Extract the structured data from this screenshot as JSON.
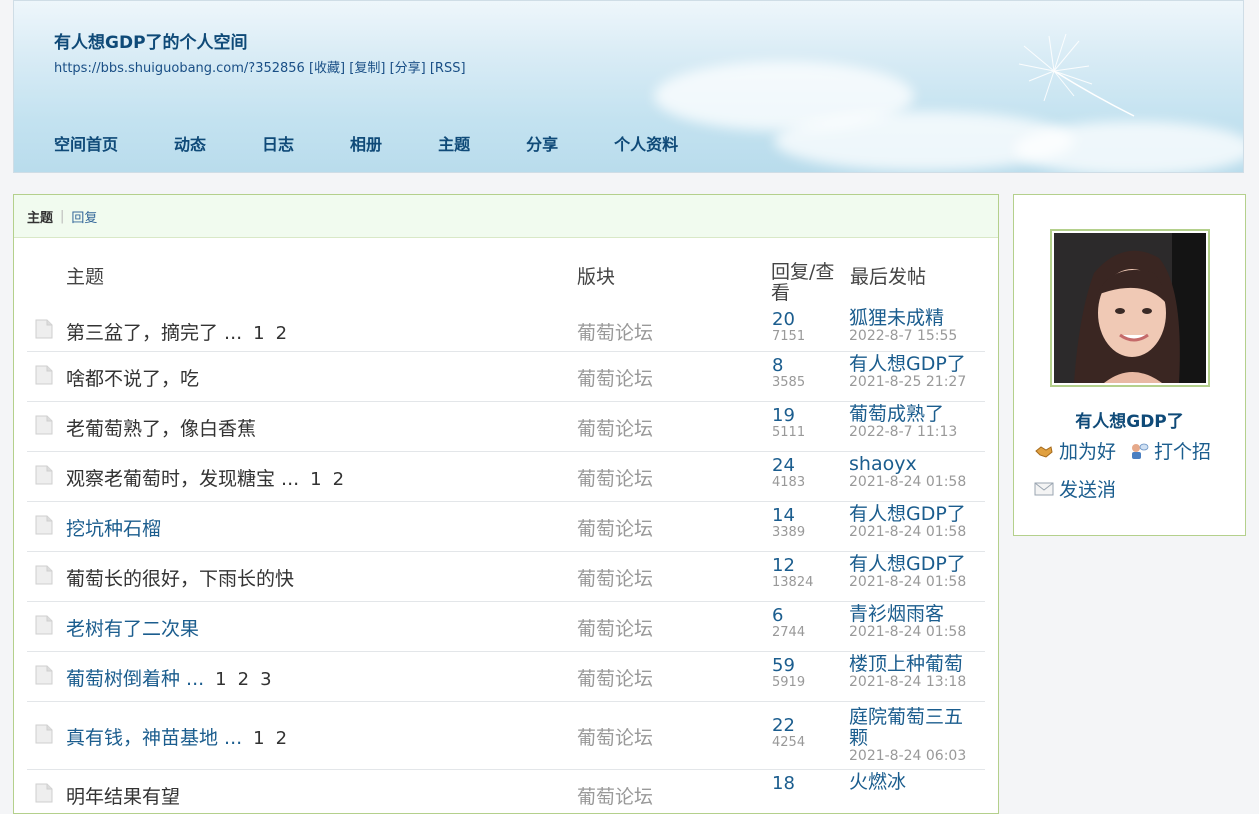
{
  "header": {
    "title": "有人想GDP了的个人空间",
    "url": "https://bbs.shuiguobang.com/?352856",
    "links": [
      "[收藏]",
      "[复制]",
      "[分享]",
      "[RSS]"
    ]
  },
  "nav": [
    "空间首页",
    "动态",
    "日志",
    "相册",
    "主题",
    "分享",
    "个人资料"
  ],
  "tabs": {
    "active": "主题",
    "other": "回复"
  },
  "table": {
    "headers": {
      "subject": "主题",
      "forum": "版块",
      "stats": "回复/查看",
      "last": "最后发帖"
    },
    "rows": [
      {
        "subject": "第三盆了，摘完了 ...",
        "pages": [
          "1",
          "2"
        ],
        "forum": "葡萄论坛",
        "replies": "20",
        "views": "7151",
        "last_user": "狐狸未成精",
        "last_time": "2022-8-7 15:55",
        "visited": false
      },
      {
        "subject": "啥都不说了，吃",
        "pages": [],
        "forum": "葡萄论坛",
        "replies": "8",
        "views": "3585",
        "last_user": "有人想GDP了",
        "last_time": "2021-8-25 21:27",
        "visited": false
      },
      {
        "subject": "老葡萄熟了，像白香蕉",
        "pages": [],
        "forum": "葡萄论坛",
        "replies": "19",
        "views": "5111",
        "last_user": "葡萄成熟了",
        "last_time": "2022-8-7 11:13",
        "visited": false
      },
      {
        "subject": "观察老葡萄时，发现糖宝 ...",
        "pages": [
          "1",
          "2"
        ],
        "forum": "葡萄论坛",
        "replies": "24",
        "views": "4183",
        "last_user": "shaoyx",
        "last_time": "2021-8-24 01:58",
        "visited": false
      },
      {
        "subject": "挖坑种石榴",
        "pages": [],
        "forum": "葡萄论坛",
        "replies": "14",
        "views": "3389",
        "last_user": "有人想GDP了",
        "last_time": "2021-8-24 01:58",
        "visited": true
      },
      {
        "subject": "葡萄长的很好，下雨长的快",
        "pages": [],
        "forum": "葡萄论坛",
        "replies": "12",
        "views": "13824",
        "last_user": "有人想GDP了",
        "last_time": "2021-8-24 01:58",
        "visited": false
      },
      {
        "subject": "老树有了二次果",
        "pages": [],
        "forum": "葡萄论坛",
        "replies": "6",
        "views": "2744",
        "last_user": "青衫烟雨客",
        "last_time": "2021-8-24 01:58",
        "visited": true
      },
      {
        "subject": "葡萄树倒着种 ...",
        "pages": [
          "1",
          "2",
          "3"
        ],
        "forum": "葡萄论坛",
        "replies": "59",
        "views": "5919",
        "last_user": "楼顶上种葡萄",
        "last_time": "2021-8-24 13:18",
        "visited": true
      },
      {
        "subject": "真有钱，神苗基地 ...",
        "pages": [
          "1",
          "2"
        ],
        "forum": "葡萄论坛",
        "replies": "22",
        "views": "4254",
        "last_user": "庭院葡萄三五颗",
        "last_time": "2021-8-24 06:03",
        "visited": true
      },
      {
        "subject": "明年结果有望",
        "pages": [],
        "forum": "葡萄论坛",
        "replies": "18",
        "views": "",
        "last_user": "火燃冰",
        "last_time": "",
        "visited": false
      }
    ]
  },
  "sidebar": {
    "username": "有人想GDP了",
    "actions": {
      "add_friend": "加为好",
      "greet": "打个招",
      "message": "发送消"
    }
  },
  "colors": {
    "link": "#1b5d8e",
    "border_green": "#b4d08c",
    "tab_bg": "#f1fbef",
    "title": "#0f4a78"
  }
}
